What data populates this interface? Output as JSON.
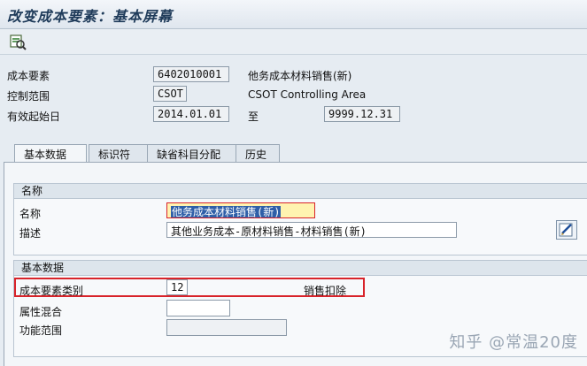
{
  "title": "改变成本要素：基本屏幕",
  "toolbar": {
    "icon": "display-change-icon"
  },
  "header": {
    "cost_element_label": "成本要素",
    "cost_element_value": "6402010001",
    "cost_element_desc": "他务成本材料销售(新)",
    "controlling_area_label": "控制范围",
    "controlling_area_value": "CSOT",
    "controlling_area_desc": "CSOT Controlling Area",
    "valid_from_label": "有效起始日",
    "valid_from_value": "2014.01.01",
    "to_label": "至",
    "valid_to_value": "9999.12.31"
  },
  "tabs": [
    "基本数据",
    "标识符",
    "缺省科目分配",
    "历史"
  ],
  "name_group": {
    "title": "名称",
    "name_label": "名称",
    "name_value": "他务成本材料销售(新)",
    "desc_label": "描述",
    "desc_value": "其他业务成本-原材料销售-材料销售(新)"
  },
  "basic_group": {
    "title": "基本数据",
    "category_label": "成本要素类别",
    "category_value": "12",
    "category_desc": "销售扣除",
    "attr_label": "属性混合",
    "attr_value": "",
    "func_label": "功能范围",
    "func_value": ""
  },
  "watermark": "知乎 @常温20度",
  "colors": {
    "highlight": "#d8232a",
    "selection": "#2f5fa8",
    "title": "#1f3b5a"
  }
}
